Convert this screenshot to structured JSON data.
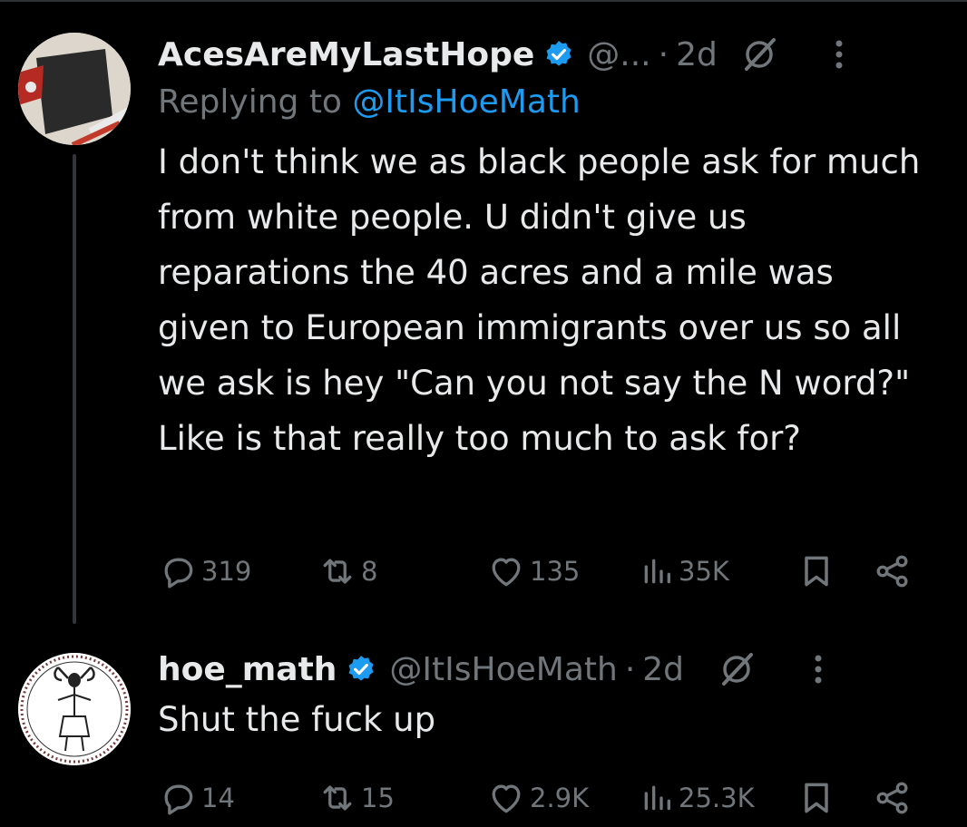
{
  "tweets": [
    {
      "name": "AcesAreMyLastHope",
      "handle": "@...",
      "separator": "·",
      "time": "2d",
      "replying_prefix": "Replying to ",
      "replying_handle": "@ItIsHoeMath",
      "text": "I don't think we as black people ask for much from white people. U didn't give us reparations the 40 acres and a mile was given to European immigrants over us so all we ask is hey \"Can you not say the N word?\" Like is that really too much to ask for?",
      "replies": "319",
      "reposts": "8",
      "likes": "135",
      "views": "35K"
    },
    {
      "name": "hoe_math",
      "handle": "@ItIsHoeMath",
      "separator": "·",
      "time": "2d",
      "text": "Shut the fuck up",
      "replies": "14",
      "reposts": "15",
      "likes": "2.9K",
      "views": "25.3K"
    }
  ],
  "icons": {
    "verified": "verified-badge-icon",
    "grok": "grok-icon",
    "more": "more-dots-icon",
    "reply": "reply-bubble-icon",
    "repost": "repost-icon",
    "like": "heart-icon",
    "views": "views-bars-icon",
    "bookmark": "bookmark-icon",
    "share": "share-icon"
  },
  "colors": {
    "background": "#000000",
    "text": "#e7e9ea",
    "muted": "#71767b",
    "accent": "#1d9bf0",
    "divider": "#2f3336"
  }
}
